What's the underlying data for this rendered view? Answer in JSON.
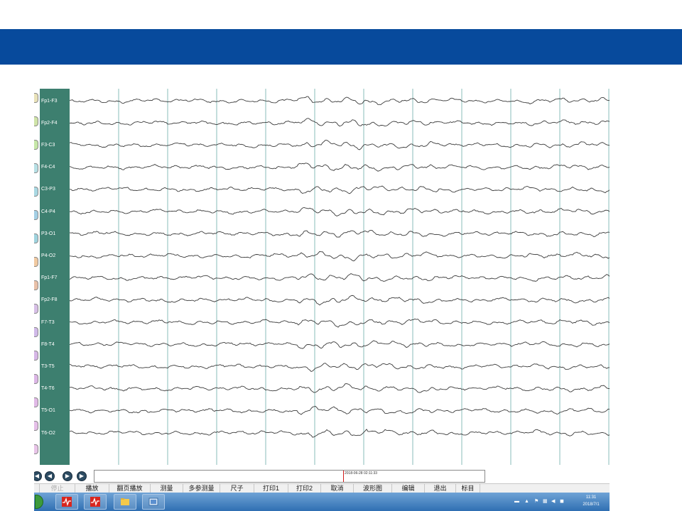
{
  "channels": [
    "Fp1-F3",
    "Fp2-F4",
    "F3-C3",
    "F4-C4",
    "C3-P3",
    "C4-P4",
    "P3-O1",
    "P4-O2",
    "Fp1-F7",
    "Fp2-F8",
    "F7-T3",
    "F8-T4",
    "T3-T5",
    "T4-T6",
    "T5-O1",
    "T6-O2"
  ],
  "channel_tab_colors": [
    "#e9e2b9",
    "#cfe3a8",
    "#c6e7a8",
    "#b7e0e5",
    "#a9d8e2",
    "#a3cfe4",
    "#9fd3de",
    "#f0c9a1",
    "#e8c0a8",
    "#d7bfe6",
    "#d0b9e8",
    "#d6b6e6",
    "#dcb6e6",
    "#e0b9e6",
    "#e5bfe8",
    "#e8c4e8"
  ],
  "navigation": {
    "first_icon": "first-page-icon",
    "prev_icon": "previous-page-icon",
    "next_icon": "next-page-icon",
    "last_icon": "last-page-icon",
    "cursor_timestamp": "2018-06-28 02:11:33"
  },
  "toolbar": {
    "stop_label": "停止",
    "play_label": "播放",
    "page_play_label": "翻页播放",
    "measure_label": "测量",
    "multi_measure_label": "多参测量",
    "ruler_label": "尺子",
    "print1_label": "打印1",
    "print2_label": "打印2",
    "cancel_label": "取消",
    "waveform_label": "波形图",
    "edit_label": "编辑",
    "exit_label": "退出",
    "marker_label": "标目"
  },
  "taskbar": {
    "tray_time": "11:31",
    "tray_date": "2018/7/1"
  },
  "colors": {
    "banner": "#074a9c",
    "label_column": "#3d7f6f",
    "trace": "#3a3a3a",
    "gridline": "#9cc8c6",
    "cursor": "#d11a1a"
  }
}
